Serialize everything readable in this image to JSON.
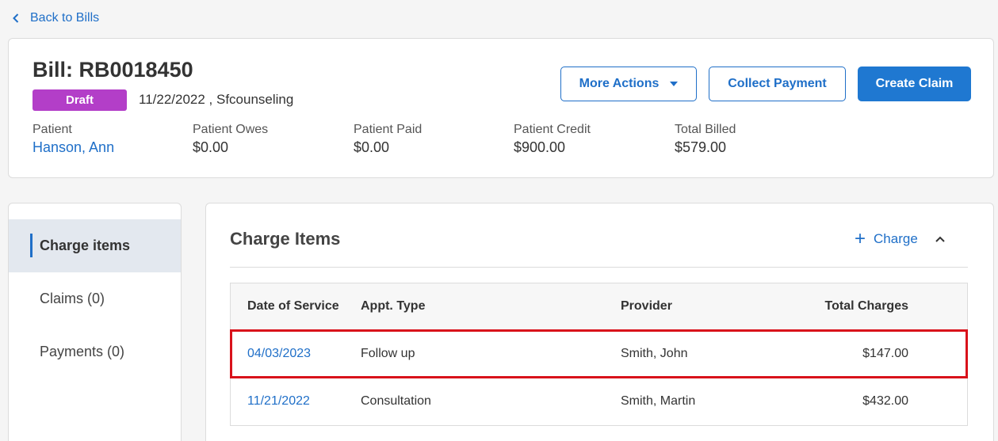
{
  "nav": {
    "back_label": "Back to Bills"
  },
  "bill": {
    "title": "Bill: RB0018450",
    "status": "Draft",
    "meta": "11/22/2022 , Sfcounseling"
  },
  "actions": {
    "more_actions": "More Actions",
    "collect_payment": "Collect Payment",
    "create_claim": "Create Claim"
  },
  "summary": [
    {
      "label": "Patient",
      "value": "Hanson, Ann"
    },
    {
      "label": "Patient Owes",
      "value": "$0.00"
    },
    {
      "label": "Patient Paid",
      "value": "$0.00"
    },
    {
      "label": "Patient Credit",
      "value": "$900.00"
    },
    {
      "label": "Total Billed",
      "value": "$579.00"
    }
  ],
  "sidebar": {
    "items": [
      {
        "label": "Charge items",
        "active": true
      },
      {
        "label": "Claims (0)",
        "active": false
      },
      {
        "label": "Payments (0)",
        "active": false
      }
    ]
  },
  "charges": {
    "title": "Charge Items",
    "add_label": "Charge",
    "columns": [
      "Date of Service",
      "Appt. Type",
      "Provider",
      "Total Charges"
    ],
    "rows": [
      {
        "date": "04/03/2023",
        "type": "Follow up",
        "provider": "Smith, John",
        "total": "$147.00",
        "highlighted": true
      },
      {
        "date": "11/21/2022",
        "type": "Consultation",
        "provider": "Smith, Martin",
        "total": "$432.00",
        "highlighted": false
      }
    ]
  },
  "colors": {
    "accent": "#1f6fc8",
    "primary_button": "#1f78d1",
    "draft_badge": "#b33ec8",
    "highlight_border": "#d9121b"
  }
}
